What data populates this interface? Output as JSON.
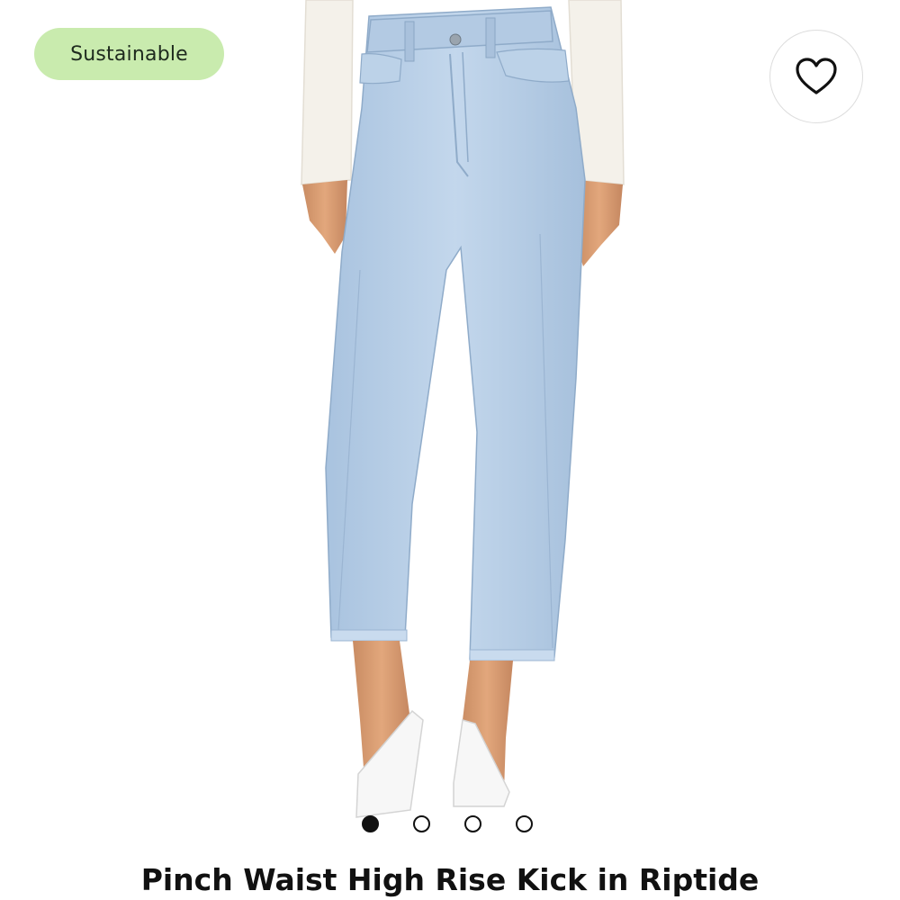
{
  "badge": {
    "label": "Sustainable",
    "color": "#c9ebae"
  },
  "favorite": {
    "icon": "heart-outline-icon"
  },
  "carousel": {
    "total": 4,
    "active_index": 0
  },
  "product": {
    "title": "Pinch Waist High Rise Kick in Riptide"
  }
}
